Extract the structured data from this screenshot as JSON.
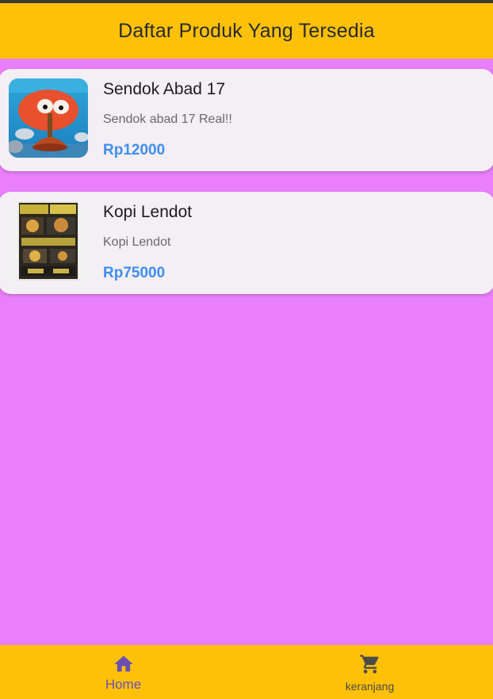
{
  "app_bar": {
    "title": "Daftar Produk Yang Tersedia"
  },
  "colors": {
    "app_bar_bg": "#ffc107",
    "page_bg": "#e97ffb",
    "card_bg": "#f4eff4",
    "price": "#3f8ef0",
    "nav_active": "#6a4fb5"
  },
  "products": [
    {
      "name": "Sendok Abad 17",
      "description": "Sendok abad 17 Real!!",
      "price": "Rp12000",
      "image_icon": "cartoon-plunger-image"
    },
    {
      "name": "Kopi Lendot",
      "description": "Kopi Lendot",
      "price": "Rp75000",
      "image_icon": "coffee-package-image"
    }
  ],
  "bottom_nav": {
    "items": [
      {
        "label": "Home",
        "icon": "home-icon",
        "active": true
      },
      {
        "label": "keranjang",
        "icon": "cart-icon",
        "active": false
      }
    ]
  }
}
